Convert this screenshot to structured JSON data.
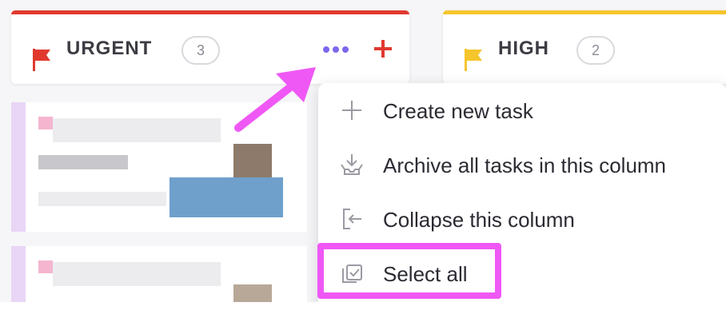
{
  "columns": [
    {
      "title": "URGENT",
      "count": "3",
      "color": "#e03a2f",
      "flag_icon": "flag-icon"
    },
    {
      "title": "HIGH",
      "count": "2",
      "color": "#f5c52c",
      "flag_icon": "flag-icon"
    }
  ],
  "column_menu": {
    "trigger_icon": "more-dots-icon",
    "add_icon": "plus-icon",
    "items": [
      {
        "label": "Create new task",
        "icon": "plus-icon"
      },
      {
        "label": "Archive all tasks in this column",
        "icon": "archive-icon"
      },
      {
        "label": "Collapse this column",
        "icon": "collapse-icon"
      },
      {
        "label": "Select all",
        "icon": "select-all-icon"
      }
    ]
  },
  "annotation": {
    "color": "#ef58f5",
    "highlighted_item": "Select all"
  },
  "colors": {
    "accent": "#7b68ee",
    "urgent": "#e03a2f",
    "high": "#f5c52c"
  }
}
